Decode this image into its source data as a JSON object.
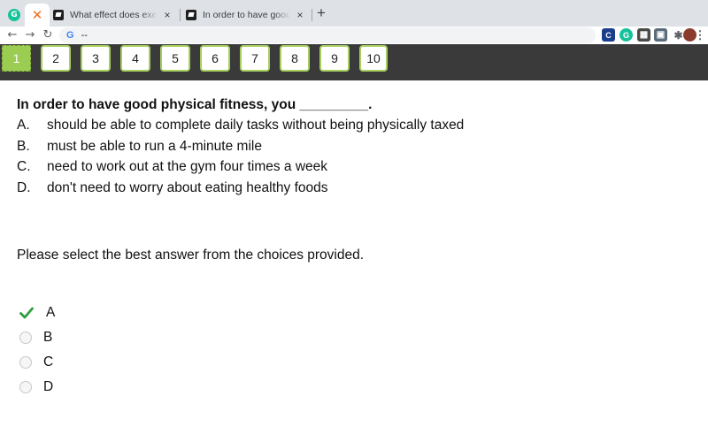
{
  "browser": {
    "tabs": [
      {
        "title": "What effect does exercise have",
        "close": "×"
      },
      {
        "title": "In order to have good physical",
        "close": "×"
      }
    ],
    "pinned": [
      {
        "icon": "grammarly-icon",
        "glyph": "G"
      },
      {
        "icon": "x-logo-icon",
        "glyph": "✕"
      }
    ],
    "new_tab": "+",
    "nav": {
      "back": "←",
      "forward": "→",
      "reload": "↻"
    },
    "address": {
      "g_glyph": "G",
      "url": "--"
    },
    "extensions": [
      {
        "name": "c-extension-icon",
        "glyph": "C",
        "color": "#1a3e8c"
      },
      {
        "name": "grammarly-extension-icon",
        "glyph": "G",
        "color": "#15c39a"
      },
      {
        "name": "calendar-extension-icon",
        "glyph": "▦",
        "color": "#4a4a4a"
      },
      {
        "name": "doc-extension-icon",
        "glyph": "▣",
        "color": "#5a6b7b"
      },
      {
        "name": "puzzle-extension-icon",
        "glyph": "✱",
        "color": "#5f6368"
      },
      {
        "name": "profile-avatar-icon",
        "glyph": "●",
        "color": "#8a3c2c"
      },
      {
        "name": "menu-icon",
        "glyph": "⋮",
        "color": "#5f6368"
      }
    ]
  },
  "quiz_nav": {
    "buttons": [
      "1",
      "2",
      "3",
      "4",
      "5",
      "6",
      "7",
      "8",
      "9",
      "10"
    ],
    "current_index": 0
  },
  "question": {
    "text": "In order to have good physical fitness, you _________.",
    "choices": [
      {
        "letter": "A.",
        "text": "should be able to complete daily tasks without being physically taxed"
      },
      {
        "letter": "B.",
        "text": "must be able to run a 4-minute mile"
      },
      {
        "letter": "C.",
        "text": "need to work out at the gym four times a week"
      },
      {
        "letter": "D.",
        "text": "don't need to worry about eating healthy foods"
      }
    ],
    "prompt": "Please select the best answer from the choices provided."
  },
  "answers": {
    "options": [
      "A",
      "B",
      "C",
      "D"
    ],
    "selected": "A"
  },
  "colors": {
    "accent_green": "#9acd52",
    "check_green": "#2e9e3e",
    "nav_bar": "#3a3a3a"
  }
}
